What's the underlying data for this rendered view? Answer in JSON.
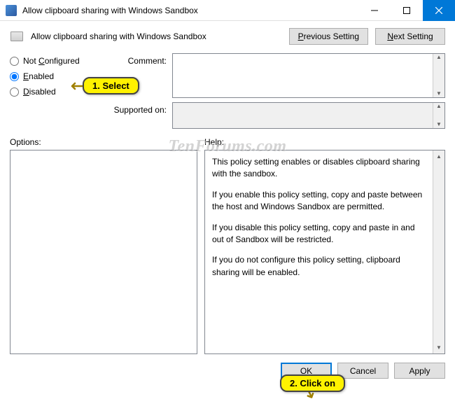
{
  "titlebar": {
    "text": "Allow clipboard sharing with Windows Sandbox"
  },
  "header": {
    "title": "Allow clipboard sharing with Windows Sandbox",
    "prev": "Previous Setting",
    "next": "Next Setting"
  },
  "radios": {
    "not_configured": "Not Configured",
    "enabled": "Enabled",
    "disabled": "Disabled",
    "selected": "enabled"
  },
  "fields": {
    "comment_label": "Comment:",
    "comment_value": "",
    "supported_label": "Supported on:",
    "supported_value": ""
  },
  "panels": {
    "options_label": "Options:",
    "help_label": "Help:",
    "help_paragraphs": [
      "This policy setting enables or disables clipboard sharing with the sandbox.",
      "If you enable this policy setting, copy and paste between the host and Windows Sandbox are permitted.",
      "If you disable this policy setting, copy and paste in and out of Sandbox will be restricted.",
      "If you do not configure this policy setting, clipboard sharing will be enabled."
    ]
  },
  "footer": {
    "ok": "OK",
    "cancel": "Cancel",
    "apply": "Apply"
  },
  "callouts": {
    "select": "1. Select",
    "click": "2. Click on"
  },
  "watermark": "TenForums.com"
}
